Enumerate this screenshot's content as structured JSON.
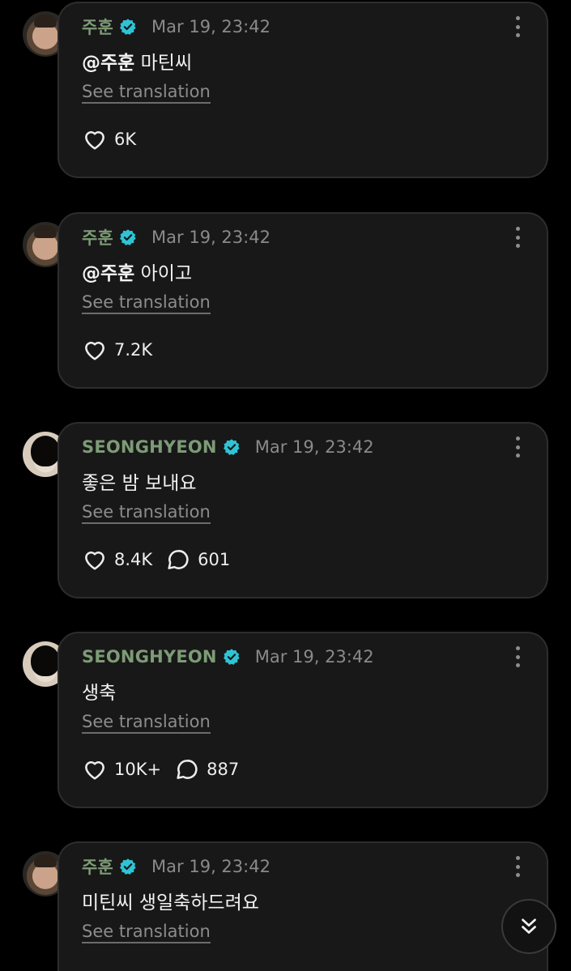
{
  "posts": [
    {
      "author": "주훈",
      "timestamp": "Mar 19, 23:42",
      "mention": "@주훈",
      "text": " 마틴씨",
      "translate_label": "See translation",
      "likes": "6K",
      "comments": ""
    },
    {
      "author": "주훈",
      "timestamp": "Mar 19, 23:42",
      "mention": "@주훈",
      "text": " 아이고",
      "translate_label": "See translation",
      "likes": "7.2K",
      "comments": ""
    },
    {
      "author": "SEONGHYEON",
      "timestamp": "Mar 19, 23:42",
      "mention": "",
      "text": "좋은 밤 보내요",
      "translate_label": "See translation",
      "likes": "8.4K",
      "comments": "601"
    },
    {
      "author": "SEONGHYEON",
      "timestamp": "Mar 19, 23:42",
      "mention": "",
      "text": "생축",
      "translate_label": "See translation",
      "likes": "10K+",
      "comments": "887"
    },
    {
      "author": "주훈",
      "timestamp": "Mar 19, 23:42",
      "mention": "",
      "text": "미틴씨 생일축하드려요",
      "translate_label": "See translation",
      "likes": "",
      "comments": ""
    }
  ],
  "icons": {
    "verified": "verified-badge-icon",
    "like": "heart-icon",
    "comment": "speech-bubble-icon",
    "more": "more-vertical-icon",
    "scroll": "double-chevron-down-icon"
  },
  "colors": {
    "background": "#000000",
    "card": "#181818",
    "author": "#7d9b76",
    "verified": "#2ec4d6",
    "muted": "#8a8a8a"
  }
}
